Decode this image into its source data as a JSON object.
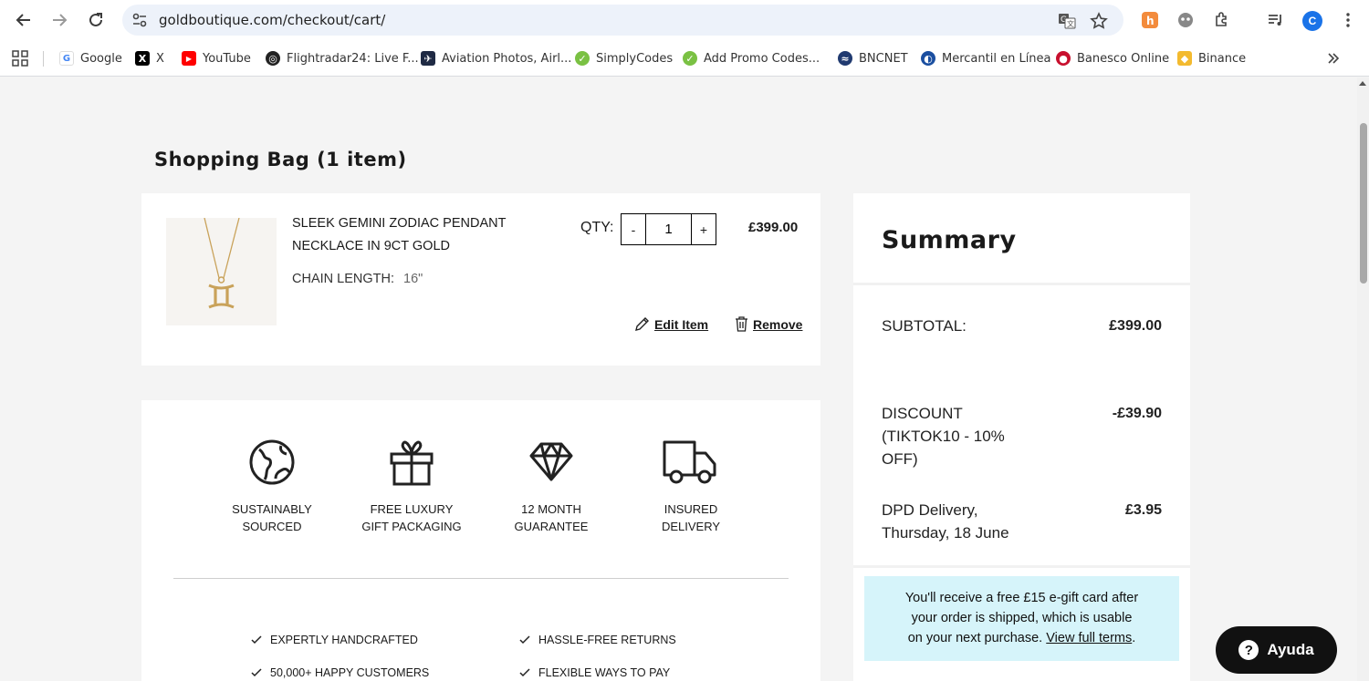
{
  "browser": {
    "url": "goldboutique.com/checkout/cart/",
    "profile_initial": "C",
    "bookmarks": [
      {
        "label": "Google"
      },
      {
        "label": "X"
      },
      {
        "label": "YouTube"
      },
      {
        "label": "Flightradar24: Live F..."
      },
      {
        "label": "Aviation Photos, Airl..."
      },
      {
        "label": "SimplyCodes"
      },
      {
        "label": "Add Promo Codes..."
      },
      {
        "label": "BNCNET"
      },
      {
        "label": "Mercantil en Línea"
      },
      {
        "label": "Banesco Online"
      },
      {
        "label": "Binance"
      }
    ]
  },
  "cart": {
    "title": "Shopping Bag (1 item)",
    "item": {
      "name": "SLEEK GEMINI ZODIAC PENDANT NECKLACE IN 9CT GOLD",
      "option_label": "CHAIN LENGTH:",
      "option_value": "16\"",
      "qty_label": "QTY:",
      "qty_minus": "-",
      "qty_plus": "+",
      "qty_value": "1",
      "price": "£399.00",
      "edit_label": "Edit Item",
      "remove_label": "Remove"
    },
    "features": [
      {
        "line1": "SUSTAINABLY",
        "line2": "SOURCED",
        "icon": "globe-icon"
      },
      {
        "line1": "FREE LUXURY",
        "line2": "GIFT PACKAGING",
        "icon": "gift-icon"
      },
      {
        "line1": "12 MONTH",
        "line2": "GUARANTEE",
        "icon": "diamond-icon"
      },
      {
        "line1": "INSURED",
        "line2": "DELIVERY",
        "icon": "truck-icon"
      }
    ],
    "perks": [
      "EXPERTLY HANDCRAFTED",
      "HASSLE-FREE RETURNS",
      "50,000+ HAPPY CUSTOMERS",
      "FLEXIBLE WAYS TO PAY"
    ]
  },
  "summary": {
    "title": "Summary",
    "subtotal_label": "SUBTOTAL:",
    "subtotal_value": "£399.00",
    "discount_label_1": "DISCOUNT",
    "discount_label_2": "(TIKTOK10 - 10%",
    "discount_label_3": "OFF)",
    "discount_value": "-£39.90",
    "delivery_label_1": "DPD Delivery,",
    "delivery_label_2": "Thursday, 18 June",
    "delivery_value": "£3.95",
    "gift_line1": "You'll receive a free £15 e-gift card after",
    "gift_line2": "your order is shipped, which is usable",
    "gift_line3": "on your next purchase.",
    "gift_link": "View full terms",
    "gift_end": "."
  },
  "help": {
    "label": "Ayuda",
    "q": "?"
  },
  "colors": {
    "accent_note": "#d6f4fa",
    "help_bg": "#111111"
  }
}
